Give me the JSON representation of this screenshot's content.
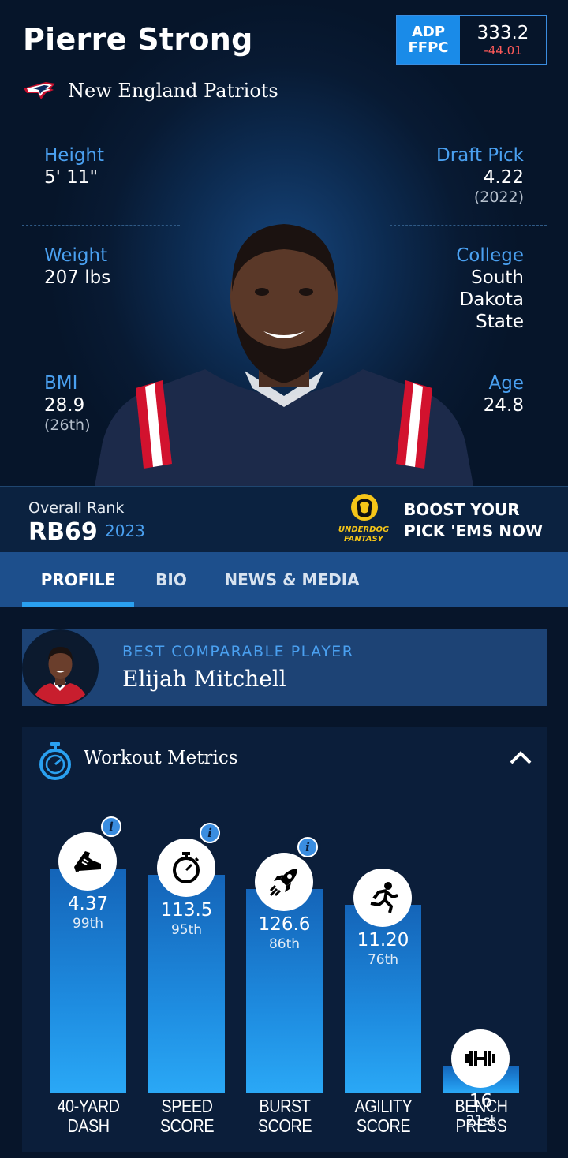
{
  "player": {
    "name": "Pierre Strong",
    "team": "New England Patriots"
  },
  "adp": {
    "label_1": "ADP",
    "label_2": "FFPC",
    "value": "333.2",
    "change": "-44.01",
    "change_color": "#ff5a5a"
  },
  "stats": {
    "height": {
      "label": "Height",
      "value": "5' 11\""
    },
    "weight": {
      "label": "Weight",
      "value": "207 lbs"
    },
    "bmi": {
      "label": "BMI",
      "value": "28.9",
      "sub": "(26th)"
    },
    "draft": {
      "label": "Draft Pick",
      "value": "4.22",
      "sub": "(2022)"
    },
    "college": {
      "label": "College",
      "value_1": "South",
      "value_2": "Dakota",
      "value_3": "State"
    },
    "age": {
      "label": "Age",
      "value": "24.8"
    }
  },
  "rank": {
    "label": "Overall Rank",
    "value": "RB69",
    "year": "2023"
  },
  "promo": {
    "logo_line_1": "UNDERDOG",
    "logo_line_2": "FANTASY",
    "line_1": "BOOST YOUR",
    "line_2": "PICK 'EMS NOW"
  },
  "tabs": [
    {
      "label": "PROFILE",
      "active": true
    },
    {
      "label": "BIO",
      "active": false
    },
    {
      "label": "NEWS & MEDIA",
      "active": false
    }
  ],
  "comparable": {
    "label": "BEST COMPARABLE PLAYER",
    "name": "Elijah Mitchell"
  },
  "workout": {
    "title": "Workout Metrics",
    "metrics": [
      {
        "value": "4.37",
        "percentile": "99th",
        "label_1": "40-YARD",
        "label_2": "DASH",
        "icon": "running-shoe-icon",
        "info": true,
        "pct": 99
      },
      {
        "value": "113.5",
        "percentile": "95th",
        "label_1": "SPEED",
        "label_2": "SCORE",
        "icon": "stopwatch-icon",
        "info": true,
        "pct": 95
      },
      {
        "value": "126.6",
        "percentile": "86th",
        "label_1": "BURST",
        "label_2": "SCORE",
        "icon": "rocket-icon",
        "info": true,
        "pct": 86
      },
      {
        "value": "11.20",
        "percentile": "76th",
        "label_1": "AGILITY",
        "label_2": "SCORE",
        "icon": "running-man-icon",
        "info": false,
        "pct": 76
      },
      {
        "value": "16",
        "percentile": "21st",
        "label_1": "BENCH",
        "label_2": "PRESS",
        "icon": "dumbbell-icon",
        "info": false,
        "pct": 21
      }
    ]
  },
  "colors": {
    "accent": "#4aa0f0",
    "bar_top": "#1464b8",
    "bar_bottom": "#2aa8f6",
    "tab_bar": "#1d4f8c"
  }
}
